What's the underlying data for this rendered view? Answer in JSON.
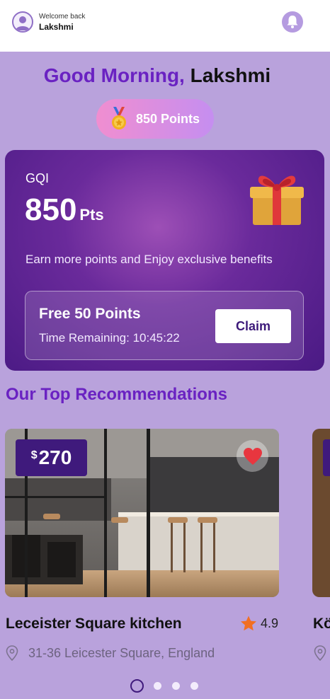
{
  "header": {
    "welcome_text": "Welcome back",
    "user_name": "Lakshmi",
    "icons": [
      "user-avatar-icon",
      "bell-icon"
    ]
  },
  "greeting": {
    "prefix": "Good Morning,",
    "name": "Lakshmi"
  },
  "points_pill": {
    "label": "850 Points",
    "icon": "medal-icon"
  },
  "rewards_card": {
    "brand": "GQI",
    "points_value": "850",
    "points_unit": "Pts",
    "description": "Earn more points and Enjoy exclusive benefits",
    "icon": "gift-icon",
    "offer": {
      "title": "Free 50 Points",
      "time_remaining": "Time Remaining: 10:45:22",
      "claim_label": "Claim"
    }
  },
  "recommendations": {
    "title": "Our Top Recommendations",
    "items": [
      {
        "currency": "$",
        "price": "270",
        "name": "Leceister Square kitchen",
        "rating": "4.9",
        "address": "31-36 Leicester Square, England",
        "favorite": true
      },
      {
        "name": "Kö"
      }
    ],
    "pagination": {
      "total": 4,
      "active_index": 0
    }
  },
  "colors": {
    "background": "#b9a2dc",
    "accent_purple": "#6a22c2",
    "dark_purple": "#3f1a7c",
    "heart_red": "#e8363f",
    "star_orange": "#f26f22"
  }
}
